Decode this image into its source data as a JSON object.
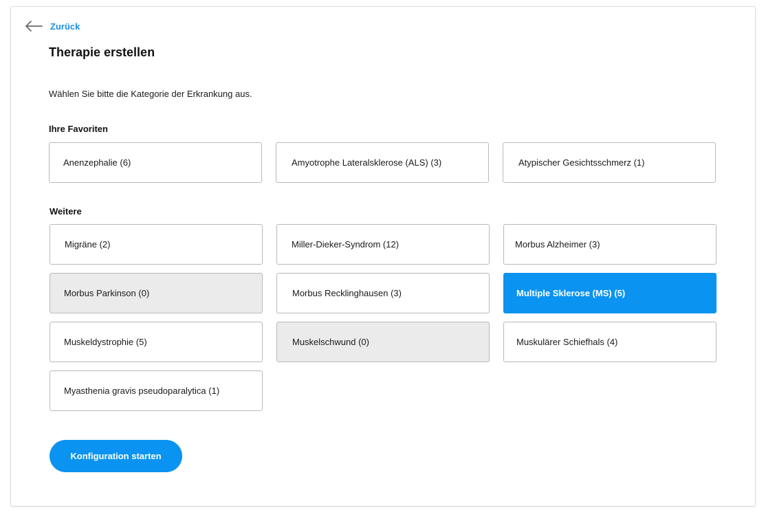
{
  "back": {
    "label": "Zurück",
    "icon": "arrow-left-icon"
  },
  "page": {
    "title": "Therapie erstellen",
    "instruction": "Wählen Sie bitte die Kategorie der Erkrankung aus."
  },
  "favorites": {
    "heading": "Ihre Favoriten",
    "items": [
      {
        "label": "Anenzephalie (6)",
        "state": "normal"
      },
      {
        "label": "Amyotrophe Lateralsklerose (ALS) (3)",
        "state": "normal"
      },
      {
        "label": "Atypischer Gesichtsschmerz (1)",
        "state": "normal"
      }
    ]
  },
  "more": {
    "heading": "Weitere",
    "items": [
      {
        "label": "Migräne (2)",
        "state": "normal"
      },
      {
        "label": "Miller-Dieker-Syndrom (12)",
        "state": "normal"
      },
      {
        "label": "Morbus Alzheimer (3)",
        "state": "normal"
      },
      {
        "label": "Morbus Parkinson (0)",
        "state": "disabled"
      },
      {
        "label": "Morbus Recklinghausen (3)",
        "state": "normal"
      },
      {
        "label": "Multiple Sklerose (MS) (5)",
        "state": "selected"
      },
      {
        "label": "Muskeldystrophie (5)",
        "state": "normal"
      },
      {
        "label": "Muskelschwund (0)",
        "state": "disabled"
      },
      {
        "label": "Muskulärer Schiefhals (4)",
        "state": "normal"
      },
      {
        "label": "Myasthenia gravis pseudoparalytica (1)",
        "state": "normal"
      }
    ]
  },
  "actions": {
    "start_label": "Konfiguration starten"
  },
  "colors": {
    "accent": "#0a93f0",
    "link": "#1a8fe3",
    "disabled_bg": "#ebebeb",
    "border": "#b9b9b9"
  }
}
